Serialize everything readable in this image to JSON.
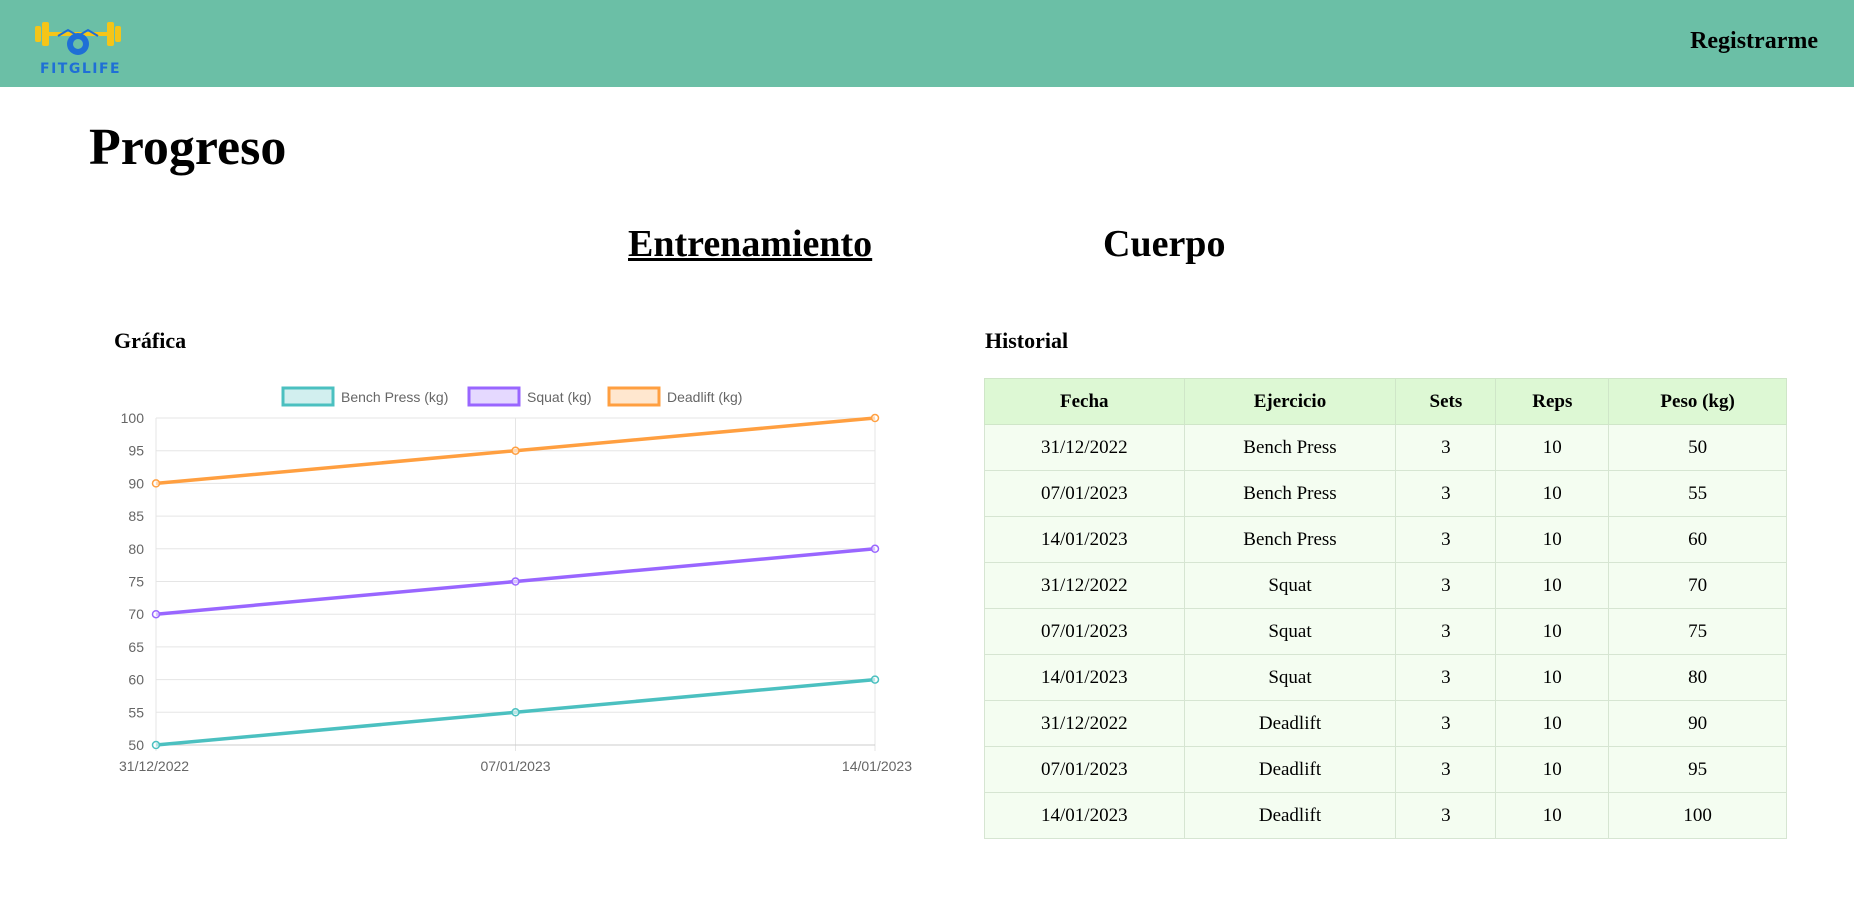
{
  "navbar": {
    "logo_text": "FITGLIFE",
    "register_label": "Registrarme",
    "bg_color": "#6bbfa6"
  },
  "page": {
    "title": "Progreso"
  },
  "tabs": [
    {
      "label": "Entrenamiento",
      "active": true
    },
    {
      "label": "Cuerpo",
      "active": false
    }
  ],
  "chart_section": {
    "title": "Gráfica"
  },
  "history_section": {
    "title": "Historial"
  },
  "chart_data": {
    "type": "line",
    "categories": [
      "31/12/2022",
      "07/01/2023",
      "14/01/2023"
    ],
    "series": [
      {
        "name": "Bench Press (kg)",
        "values": [
          50,
          55,
          60
        ],
        "color": "#4bc0c0"
      },
      {
        "name": "Squat (kg)",
        "values": [
          70,
          75,
          80
        ],
        "color": "#9966ff"
      },
      {
        "name": "Deadlift (kg)",
        "values": [
          90,
          95,
          100
        ],
        "color": "#ff9f40"
      }
    ],
    "ylim": [
      50,
      100
    ],
    "yticks": [
      "100",
      "95",
      "90",
      "85",
      "80",
      "75",
      "70",
      "65",
      "60",
      "55",
      "50"
    ],
    "grid": true,
    "legend": "top"
  },
  "table": {
    "headers": [
      "Fecha",
      "Ejercicio",
      "Sets",
      "Reps",
      "Peso (kg)"
    ],
    "rows": [
      [
        "31/12/2022",
        "Bench Press",
        "3",
        "10",
        "50"
      ],
      [
        "07/01/2023",
        "Bench Press",
        "3",
        "10",
        "55"
      ],
      [
        "14/01/2023",
        "Bench Press",
        "3",
        "10",
        "60"
      ],
      [
        "31/12/2022",
        "Squat",
        "3",
        "10",
        "70"
      ],
      [
        "07/01/2023",
        "Squat",
        "3",
        "10",
        "75"
      ],
      [
        "14/01/2023",
        "Squat",
        "3",
        "10",
        "80"
      ],
      [
        "31/12/2022",
        "Deadlift",
        "3",
        "10",
        "90"
      ],
      [
        "07/01/2023",
        "Deadlift",
        "3",
        "10",
        "95"
      ],
      [
        "14/01/2023",
        "Deadlift",
        "3",
        "10",
        "100"
      ]
    ]
  }
}
